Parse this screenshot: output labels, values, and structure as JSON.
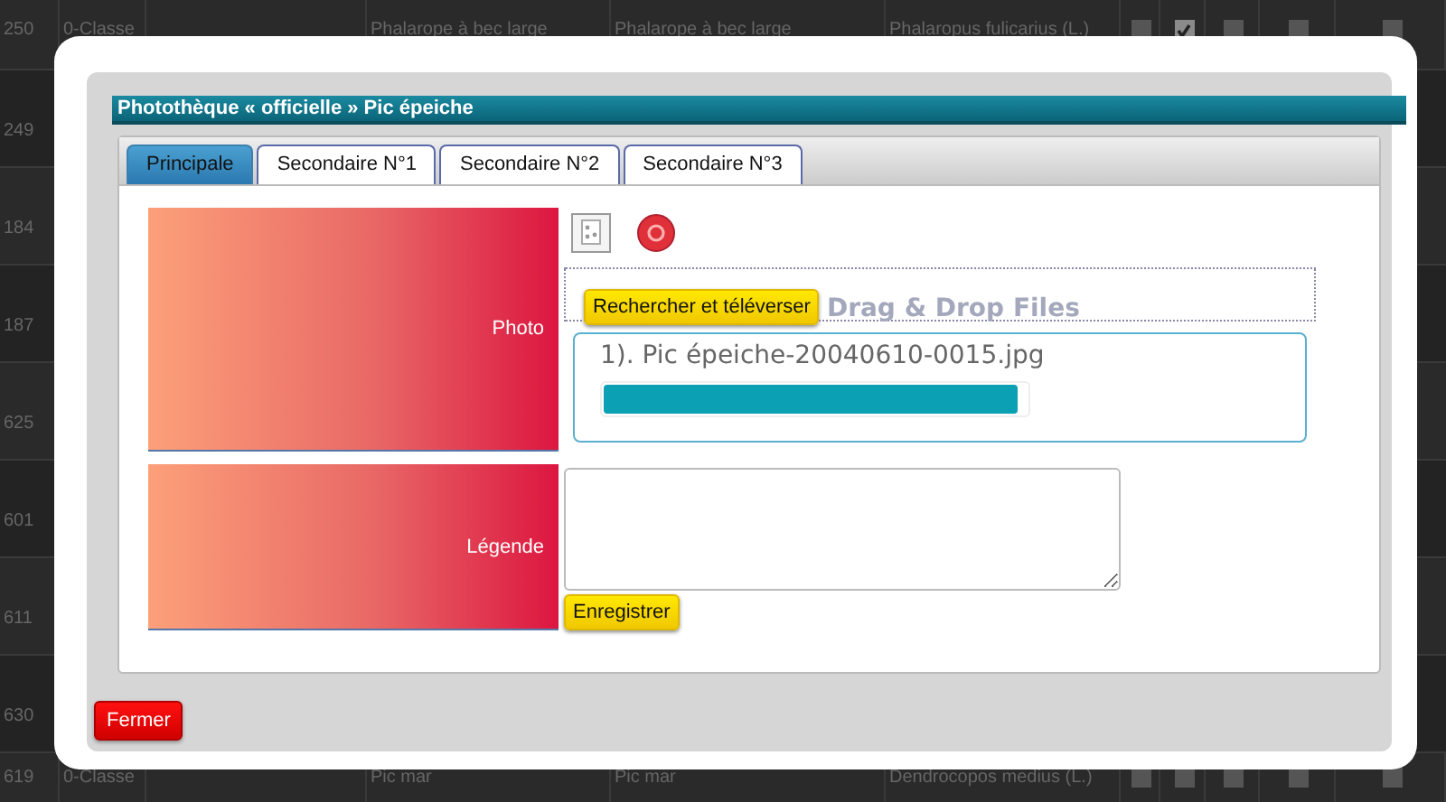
{
  "background_table": {
    "rows": [
      {
        "cells": [
          "250",
          "0-Classe",
          "",
          "Phalarope à bec large",
          "Phalarope à bec large",
          "Phalaropus fulicarius (L.)"
        ],
        "checks": [
          false,
          true,
          false,
          false,
          false
        ]
      },
      {
        "cells": [
          "249"
        ]
      },
      {
        "cells": [
          "184"
        ]
      },
      {
        "cells": [
          "187"
        ]
      },
      {
        "cells": [
          "625"
        ]
      },
      {
        "cells": [
          "601"
        ]
      },
      {
        "cells": [
          "611"
        ]
      },
      {
        "cells": [
          "630"
        ]
      },
      {
        "cells": [
          "619",
          "0-Classe",
          "",
          "Pic mar",
          "Pic mar",
          "Dendrocopos medius (L.)"
        ],
        "checks": [
          false,
          false,
          false,
          false,
          false
        ]
      }
    ]
  },
  "dialog": {
    "title": "Photothèque « officielle » Pic épeiche",
    "tabs": [
      {
        "label": "Principale",
        "selected": true
      },
      {
        "label": "Secondaire N°1",
        "selected": false
      },
      {
        "label": "Secondaire N°2",
        "selected": false
      },
      {
        "label": "Secondaire N°3",
        "selected": false
      }
    ],
    "photo": {
      "label": "Photo",
      "browse_button": "Rechercher et téléverser",
      "drop_hint": "Drag & Drop Files",
      "file": {
        "name": "1). Pic épeiche-20040610-0015.jpg",
        "level": 0.98
      }
    },
    "caption": {
      "label": "Légende",
      "save_button": "Enregistrer"
    },
    "close_button": "Fermer"
  }
}
